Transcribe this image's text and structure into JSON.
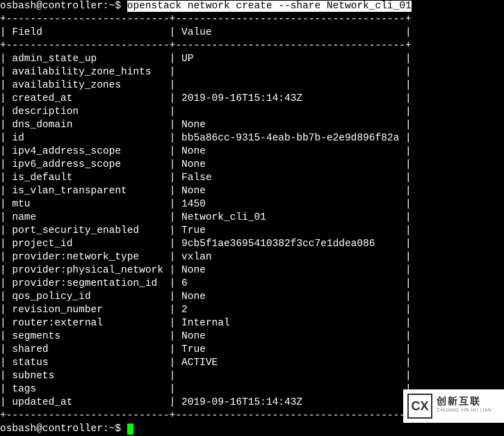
{
  "prompt1": {
    "user": "osbash@controller",
    "path": "~",
    "symbol": "$",
    "command": "openstack network create --share Network_cli_01"
  },
  "table": {
    "header_field": "Field",
    "header_value": "Value",
    "rows": [
      {
        "field": "admin_state_up",
        "value": "UP"
      },
      {
        "field": "availability_zone_hints",
        "value": ""
      },
      {
        "field": "availability_zones",
        "value": ""
      },
      {
        "field": "created_at",
        "value": "2019-09-16T15:14:43Z"
      },
      {
        "field": "description",
        "value": ""
      },
      {
        "field": "dns_domain",
        "value": "None"
      },
      {
        "field": "id",
        "value": "bb5a86cc-9315-4eab-bb7b-e2e9d896f82a"
      },
      {
        "field": "ipv4_address_scope",
        "value": "None"
      },
      {
        "field": "ipv6_address_scope",
        "value": "None"
      },
      {
        "field": "is_default",
        "value": "False"
      },
      {
        "field": "is_vlan_transparent",
        "value": "None"
      },
      {
        "field": "mtu",
        "value": "1450"
      },
      {
        "field": "name",
        "value": "Network_cli_01"
      },
      {
        "field": "port_security_enabled",
        "value": "True"
      },
      {
        "field": "project_id",
        "value": "9cb5f1ae3695410382f3cc7e1ddea086"
      },
      {
        "field": "provider:network_type",
        "value": "vxlan"
      },
      {
        "field": "provider:physical_network",
        "value": "None"
      },
      {
        "field": "provider:segmentation_id",
        "value": "6"
      },
      {
        "field": "qos_policy_id",
        "value": "None"
      },
      {
        "field": "revision_number",
        "value": "2"
      },
      {
        "field": "router:external",
        "value": "Internal"
      },
      {
        "field": "segments",
        "value": "None"
      },
      {
        "field": "shared",
        "value": "True"
      },
      {
        "field": "status",
        "value": "ACTIVE"
      },
      {
        "field": "subnets",
        "value": ""
      },
      {
        "field": "tags",
        "value": ""
      },
      {
        "field": "updated_at",
        "value": "2019-09-16T15:14:43Z"
      }
    ],
    "border_top": "+---------------------------+--------------------------------------+",
    "border_mid": "+---------------------------+--------------------------------------+",
    "border_bot": "+---------------------------+--------------------------------------+"
  },
  "prompt2": {
    "user": "osbash@controller",
    "path": "~",
    "symbol": "$"
  },
  "watermark": {
    "logo": "CX",
    "main": "创新互联",
    "sub": "CHUANG XIN HU LIAN"
  }
}
